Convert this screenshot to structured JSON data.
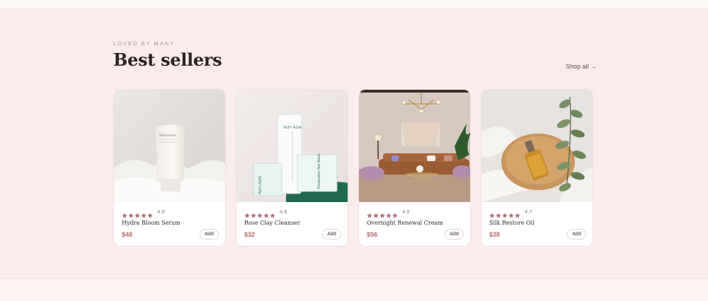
{
  "section": {
    "eyebrow": "LOVED BY MANY",
    "title": "Best sellers",
    "shop_all": "Shop all →"
  },
  "products": [
    {
      "name": "Hydra Bloom Serum",
      "rating": "4.9",
      "stars": 5,
      "price": "$48",
      "add_label": "Add",
      "image_icon": "serum-tube-image"
    },
    {
      "name": "Rose Clay Cleanser",
      "rating": "4.8",
      "stars": 5,
      "price": "$32",
      "add_label": "Add",
      "image_icon": "cleanser-tube-image"
    },
    {
      "name": "Overnight Renewal Cream",
      "rating": "4.9",
      "stars": 5,
      "price": "$56",
      "add_label": "Add",
      "image_icon": "living-room-image"
    },
    {
      "name": "Silk Restore Oil",
      "rating": "4.7",
      "stars": 5,
      "price": "$38",
      "add_label": "Add",
      "image_icon": "oil-dropper-image"
    }
  ],
  "product_labels": {
    "tube1_brand": "Mercurie",
    "tube2_brand": "Act+ Acre",
    "box_text": "Restorative Hair Mask"
  },
  "colors": {
    "section_bg": "#faeceb",
    "accent": "#b66d6e",
    "star": "#b0686b",
    "text_dark": "#2c2322"
  }
}
